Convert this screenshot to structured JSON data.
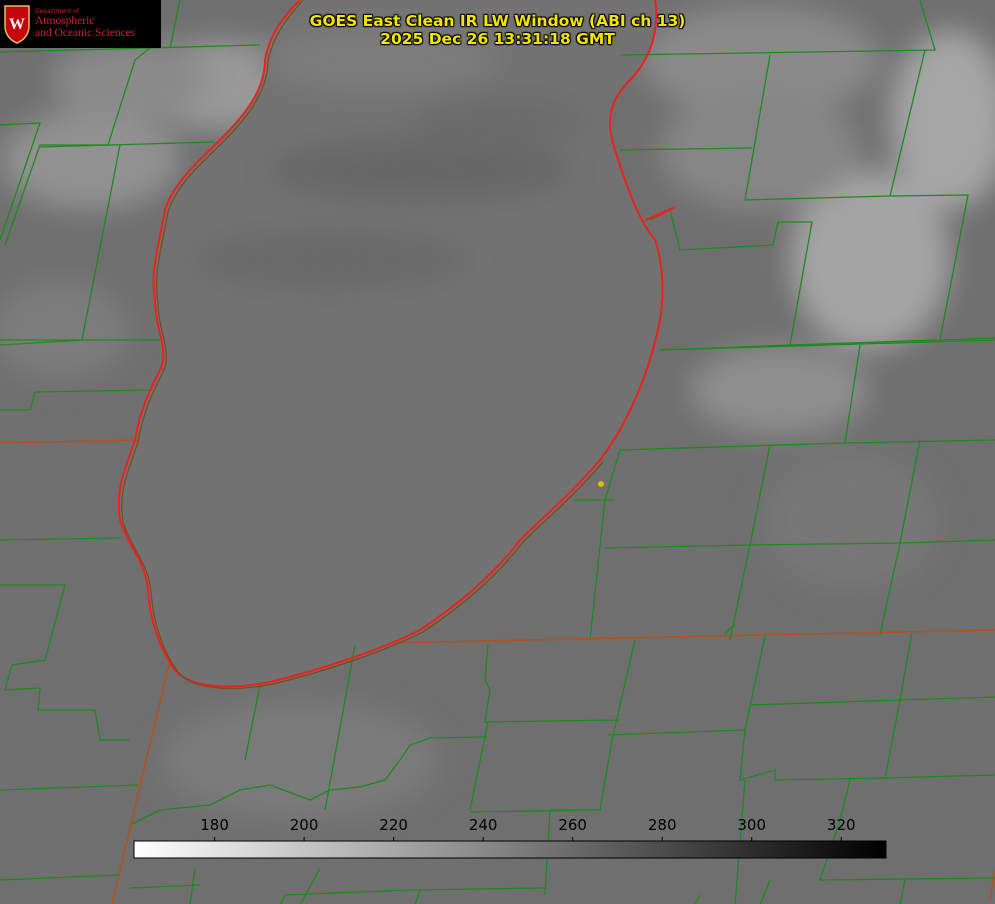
{
  "logo": {
    "department": "Department of",
    "line1": "Atmospheric",
    "line2": "and Oceanic Sciences",
    "emblem_letter": "W"
  },
  "title": {
    "line1": "GOES East Clean IR LW Window (ABI ch 13)",
    "line2": "2025 Dec 26 13:31:18 GMT"
  },
  "colorbar": {
    "min": 162,
    "max": 330,
    "ticks": [
      "180",
      "200",
      "220",
      "240",
      "260",
      "280",
      "300",
      "320"
    ],
    "gradient_start": "#ffffff",
    "gradient_end": "#000000"
  },
  "colors": {
    "coastline": "#e8231d",
    "boundaries": "#1d8a1d",
    "state_border": "#b0521c",
    "marker": "#d8c000",
    "title_text": "#f2e600",
    "logo_text": "#d0202a"
  }
}
